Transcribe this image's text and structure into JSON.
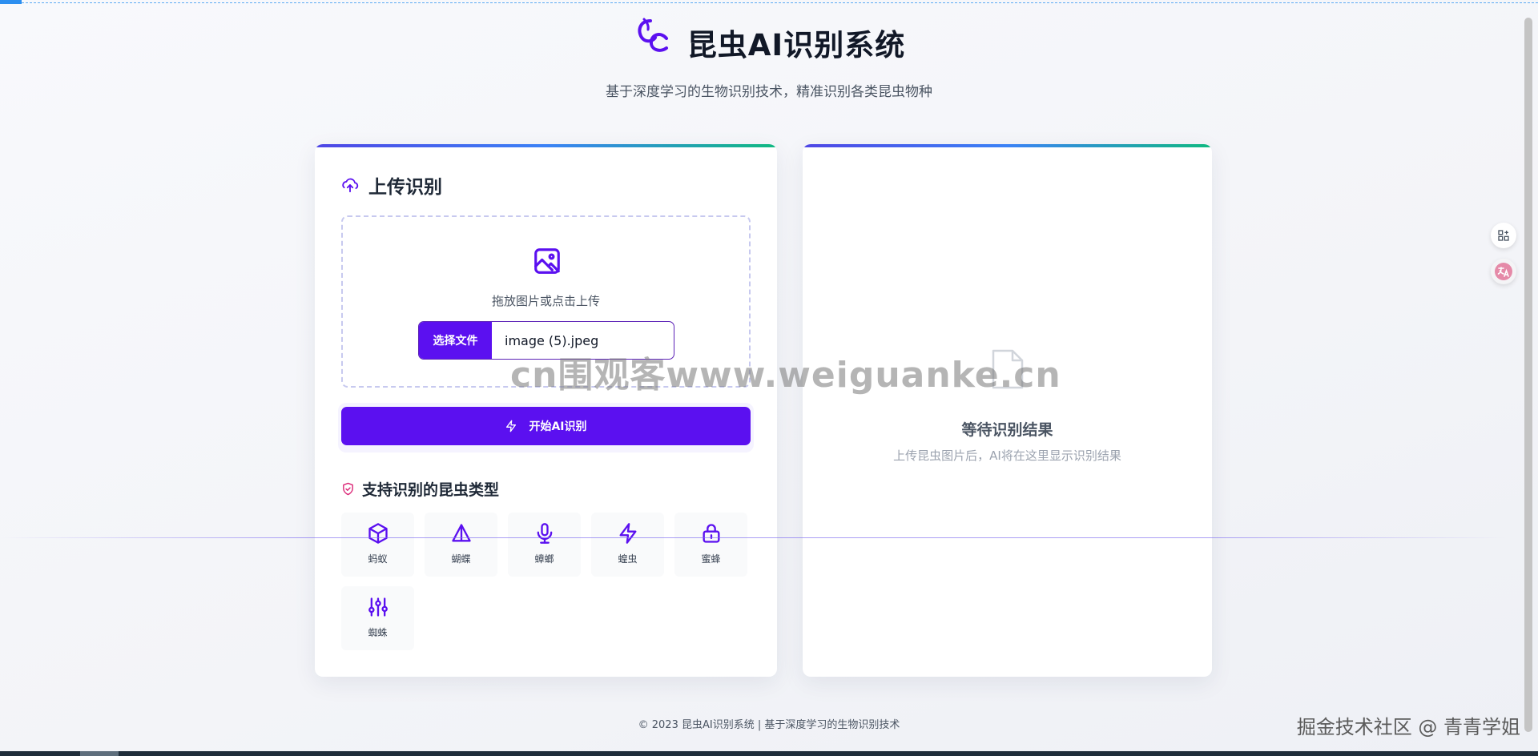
{
  "header": {
    "title": "昆虫AI识别系统",
    "subtitle": "基于深度学习的生物识别技术，精准识别各类昆虫物种"
  },
  "upload": {
    "title": "上传识别",
    "dropzone_text": "拖放图片或点击上传",
    "choose_file_label": "选择文件",
    "file_name": "image (5).jpeg",
    "start_button_label": "开始AI识别"
  },
  "types": {
    "title": "支持识别的昆虫类型",
    "items": [
      {
        "label": "蚂蚁",
        "icon": "cube-icon"
      },
      {
        "label": "蝴蝶",
        "icon": "triangle-icon"
      },
      {
        "label": "蟑螂",
        "icon": "microphone-icon"
      },
      {
        "label": "蝗虫",
        "icon": "lightning-icon"
      },
      {
        "label": "蜜蜂",
        "icon": "lock-icon"
      },
      {
        "label": "蜘蛛",
        "icon": "sliders-icon"
      }
    ]
  },
  "result": {
    "title": "等待识别结果",
    "subtitle": "上传昆虫图片后，AI将在这里显示识别结果"
  },
  "watermark": "cn围观客www.weiguanke.cn",
  "footer": "© 2023 昆虫AI识别系统 | 基于深度学习的生物识别技术",
  "corner_mark": "掘金技术社区 @ 青青学姐",
  "colors": {
    "primary": "#5b10f0",
    "accent_gradient_start": "#4f46e5",
    "accent_gradient_end": "#10b981",
    "pink": "#db2777"
  }
}
